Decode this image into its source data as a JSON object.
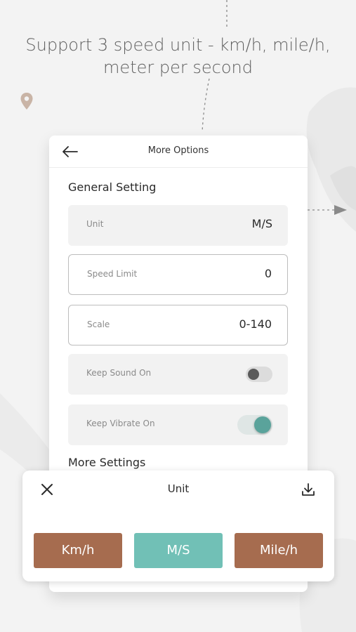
{
  "headline": "Support 3 speed unit - km/h, mile/h, meter per second",
  "colors": {
    "brown": "#a66c4f",
    "teal": "#71c0b6",
    "toggle_on": "#5aa39b",
    "pin": "#c9b4a6"
  },
  "icons": {
    "back": "back-arrow-icon",
    "pin": "location-pin-icon",
    "close": "close-icon",
    "download": "download-icon"
  },
  "phone": {
    "title": "More Options",
    "general_setting": "General Setting",
    "rows": {
      "unit": {
        "label": "Unit",
        "value": "M/S"
      },
      "speed_limit": {
        "label": "Speed Limit",
        "value": "0"
      },
      "scale": {
        "label": "Scale",
        "value": "0-140"
      },
      "keep_sound": {
        "label": "Keep Sound On",
        "enabled": false
      },
      "keep_vibrate": {
        "label": "Keep Vibrate On",
        "enabled": true
      }
    },
    "more_settings": "More Settings"
  },
  "sheet": {
    "title": "Unit",
    "options": [
      "Km/h",
      "M/S",
      "Mile/h"
    ],
    "selected": "M/S"
  }
}
